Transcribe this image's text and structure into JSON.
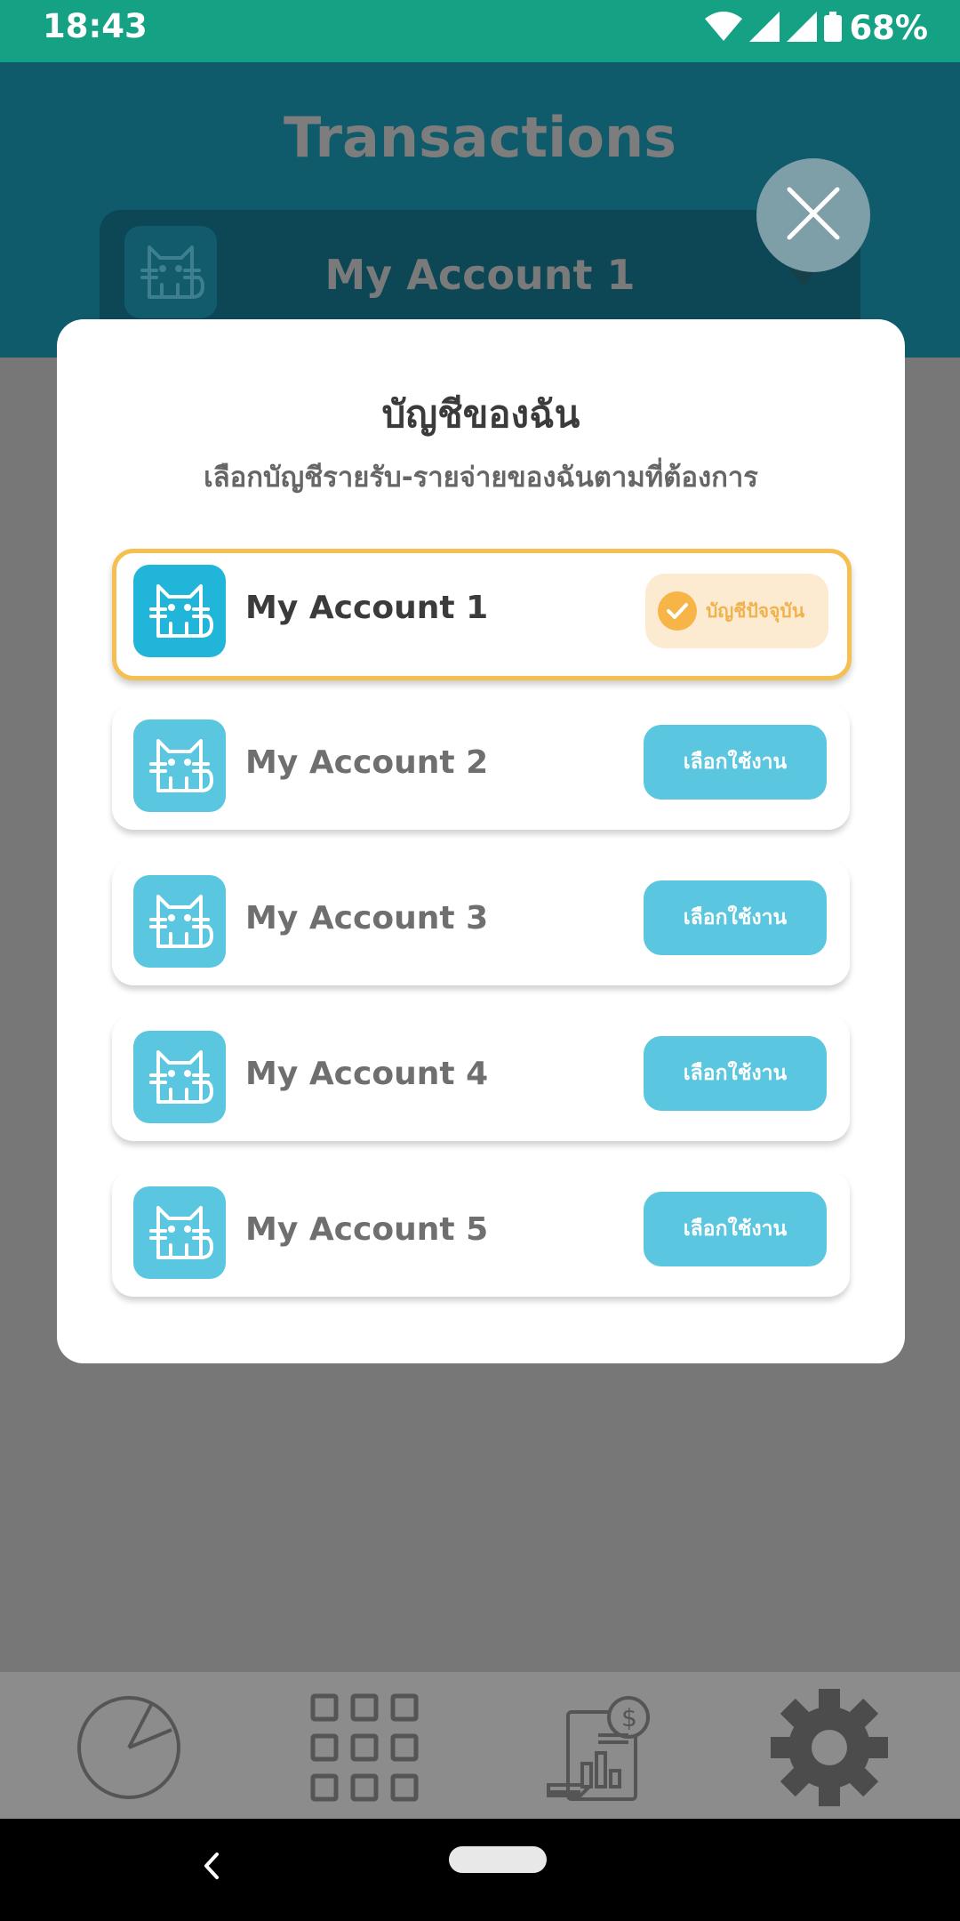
{
  "status_bar": {
    "time": "18:43",
    "battery": "68%"
  },
  "header": {
    "title": "Transactions",
    "selected_account": "My Account 1"
  },
  "modal": {
    "title": "บัญชีของฉัน",
    "subtitle": "เลือกบัญชีรายรับ-รายจ่ายของฉันตามที่ต้องการ",
    "accounts": [
      {
        "name": "My Account 1",
        "action": "บัญชีปัจจุบัน",
        "current": true
      },
      {
        "name": "My Account 2",
        "action": "เลือกใช้งาน",
        "current": false
      },
      {
        "name": "My Account 3",
        "action": "เลือกใช้งาน",
        "current": false
      },
      {
        "name": "My Account 4",
        "action": "เลือกใช้งาน",
        "current": false
      },
      {
        "name": "My Account 5",
        "action": "เลือกใช้งาน",
        "current": false
      }
    ]
  },
  "bottom_nav": {
    "items": [
      {
        "icon": "pie-chart-icon"
      },
      {
        "icon": "grid-icon"
      },
      {
        "icon": "financial-report-icon"
      },
      {
        "icon": "gear-icon"
      }
    ]
  },
  "colors": {
    "status_bar": "#15a184",
    "header": "#0f5a6b",
    "accent": "#5ac6e0",
    "selected_border": "#f5bf52",
    "overlay": "#777777"
  }
}
